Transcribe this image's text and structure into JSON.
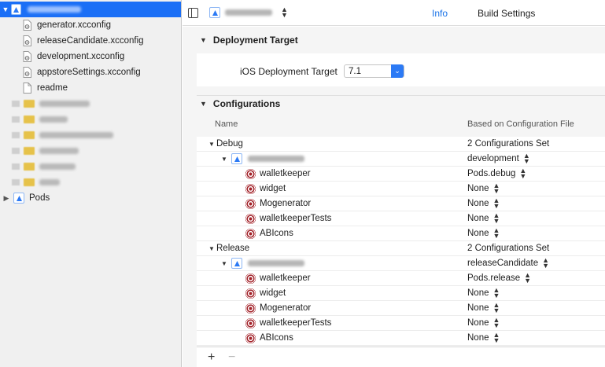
{
  "sidebar": {
    "files": [
      {
        "label": "generator.xcconfig"
      },
      {
        "label": "releaseCandidate.xcconfig"
      },
      {
        "label": "development.xcconfig"
      },
      {
        "label": "appstoreSettings.xcconfig"
      },
      {
        "label": "readme"
      }
    ],
    "pods_label": "Pods"
  },
  "topbar": {
    "tabs": [
      "Info",
      "Build Settings"
    ]
  },
  "deployment": {
    "title": "Deployment Target",
    "field_label": "iOS Deployment Target",
    "value": "7.1"
  },
  "configurations": {
    "title": "Configurations",
    "col_name": "Name",
    "col_based": "Based on Configuration File",
    "groups": [
      {
        "name": "Debug",
        "summary": "2 Configurations Set",
        "project_value": "development",
        "targets": [
          {
            "name": "walletkeeper",
            "value": "Pods.debug"
          },
          {
            "name": "widget",
            "value": "None"
          },
          {
            "name": "Mogenerator",
            "value": "None"
          },
          {
            "name": "walletkeeperTests",
            "value": "None"
          },
          {
            "name": "ABIcons",
            "value": "None"
          }
        ]
      },
      {
        "name": "Release",
        "summary": "2 Configurations Set",
        "project_value": "releaseCandidate",
        "targets": [
          {
            "name": "walletkeeper",
            "value": "Pods.release"
          },
          {
            "name": "widget",
            "value": "None"
          },
          {
            "name": "Mogenerator",
            "value": "None"
          },
          {
            "name": "walletkeeperTests",
            "value": "None"
          },
          {
            "name": "ABIcons",
            "value": "None"
          }
        ]
      }
    ]
  },
  "bottom": {
    "add": "+",
    "remove": "−"
  },
  "colors": {
    "accent": "#1b6ff6",
    "target_red": "#a3232a",
    "folder": "#e6c24a"
  }
}
